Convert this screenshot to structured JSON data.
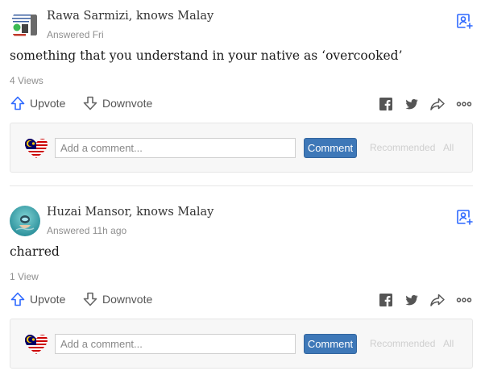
{
  "answers": [
    {
      "author": "Rawa Sarmizi, knows Malay",
      "meta": "Answered Fri",
      "text": "something that you understand in your native as ‘overcooked’",
      "views": "4 Views",
      "upvote": "Upvote",
      "downvote": "Downvote",
      "comment_placeholder": "Add a comment...",
      "comment_button": "Comment",
      "sort_recommended": "Recommended",
      "sort_all": "All"
    },
    {
      "author": "Huzai Mansor, knows Malay",
      "meta": "Answered 11h ago",
      "text": "charred",
      "views": "1 View",
      "upvote": "Upvote",
      "downvote": "Downvote",
      "comment_placeholder": "Add a comment...",
      "comment_button": "Comment",
      "sort_recommended": "Recommended",
      "sort_all": "All"
    }
  ],
  "icons": [
    "avatar",
    "follow-user-icon",
    "upvote-icon",
    "downvote-icon",
    "facebook-icon",
    "twitter-icon",
    "share-icon",
    "more-icon",
    "malaysia-flag-heart-icon"
  ],
  "colors": {
    "accent": "#2e69ff",
    "comment_button": "#3e78b8",
    "muted_text": "#8f8f8f",
    "icon": "#666666"
  }
}
